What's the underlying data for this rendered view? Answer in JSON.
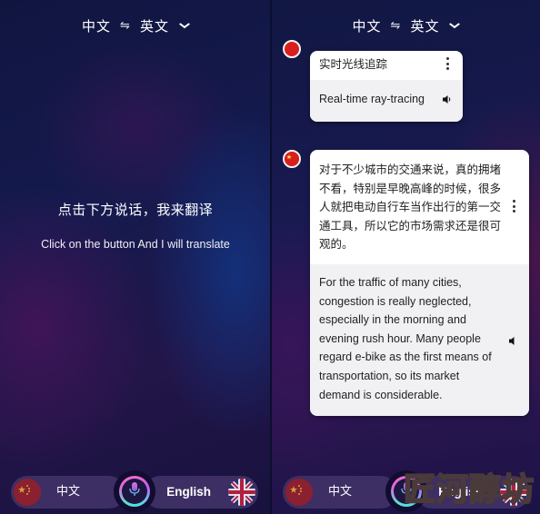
{
  "header": {
    "source_lang": "中文",
    "swap_icon": "⇋",
    "target_lang": "英文",
    "dropdown_icon": "⌄"
  },
  "left_screen": {
    "prompt_zh": "点击下方说话，我来翻译",
    "prompt_en": "Click on the button And I will translate"
  },
  "bottom_bar": {
    "left_lang_label": "中文",
    "right_lang_label": "English",
    "left_flag": "china-flag",
    "right_flag": "uk-flag",
    "mic_icon": "microphone"
  },
  "conversation": [
    {
      "source_text": "实时光线追踪",
      "translation": "Real-time ray-tracing"
    },
    {
      "source_text": "对于不少城市的交通来说，真的拥堵不看，特别是早晚高峰的时候，很多人就把电动自行车当作出行的第一交通工具，所以它的市场需求还是很可观的。",
      "translation": "For the traffic of many cities, congestion is really neglected, especially in the morning and evening rush hour. Many people regard e-bike as the first means of transportation, so its market demand is considerable."
    }
  ],
  "watermark": "匠河醇坊",
  "colors": {
    "pill_bg": "#3d2f63",
    "mic_ring_pink": "#f06cd0",
    "mic_ring_cyan": "#56d8e8",
    "card_bg": "#ffffff",
    "translation_bg": "#f1f1f3"
  }
}
